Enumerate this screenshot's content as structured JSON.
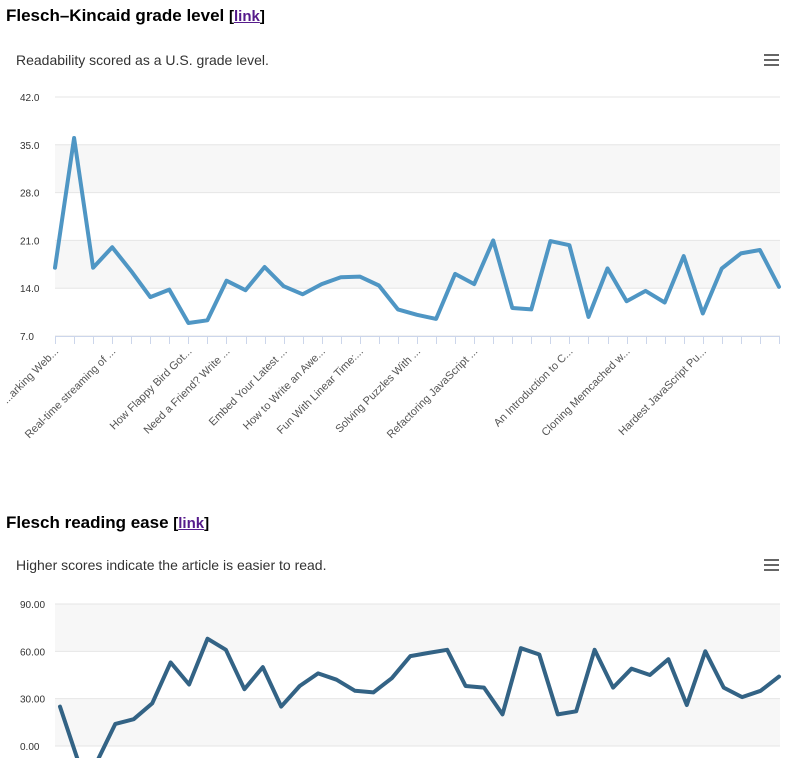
{
  "charts": [
    {
      "heading": "Flesch–Kincaid grade level",
      "link_text": "link",
      "subtitle": "Readability scored as a U.S. grade level.",
      "menu_icon": "hamburger-menu-icon",
      "color": "#4f96c4",
      "band_color": "#f7f7f7",
      "grid_color": "#e6e6e6"
    },
    {
      "heading": "Flesch reading ease",
      "link_text": "link",
      "subtitle": "Higher scores indicate the article is easier to read.",
      "menu_icon": "hamburger-menu-icon",
      "color": "#336385",
      "band_color": "#f7f7f7",
      "grid_color": "#e6e6e6"
    }
  ],
  "chart_data": [
    {
      "type": "line",
      "title": "Flesch–Kincaid grade level",
      "subtitle": "Readability scored as a U.S. grade level.",
      "xlabel": "",
      "ylabel": "",
      "ylim": [
        7,
        42
      ],
      "y_ticks": [
        "7.0",
        "14.0",
        "21.0",
        "28.0",
        "35.0",
        "42.0"
      ],
      "grid": true,
      "visible_x_labels": [
        "...arking Web...",
        "Real-time streaming of ...",
        "How Flappy Bird Got...",
        "Need a Friend? Write ...",
        "Embed Your Latest ...",
        "How to Write an Awe...",
        "Fun With Linear Time:...",
        "Solving Puzzles With ...",
        "Refactoring JavaScript ...",
        "An Introduction to C...",
        "Cloning Memcached w...",
        "Hardest JavaScript Pu..."
      ],
      "series": [
        {
          "values": [
            17,
            36,
            17,
            20,
            16.5,
            12.7,
            13.8,
            8.9,
            9.3,
            15.1,
            13.7,
            17.1,
            14.3,
            13.1,
            14.6,
            15.6,
            15.7,
            14.4,
            10.9,
            10.1,
            9.5,
            16.1,
            14.6,
            21,
            11.1,
            10.9,
            20.9,
            20.3,
            9.8,
            16.9,
            12.1,
            13.6,
            11.9,
            18.7,
            10.3,
            16.9,
            19.1,
            19.6,
            14.2
          ]
        }
      ]
    },
    {
      "type": "line",
      "title": "Flesch reading ease",
      "subtitle": "Higher scores indicate the article is easier to read.",
      "xlabel": "",
      "ylabel": "",
      "ylim": [
        0,
        90
      ],
      "y_ticks": [
        "0.00",
        "30.00",
        "60.00",
        "90.00"
      ],
      "grid": true,
      "series": [
        {
          "values": [
            25,
            -10,
            -10,
            14,
            17,
            27,
            53,
            39,
            68,
            61,
            36,
            50,
            25,
            38,
            46,
            42,
            35,
            34,
            43,
            57,
            59,
            61,
            38,
            37,
            20,
            62,
            58,
            20,
            22,
            61,
            37,
            49,
            45,
            55,
            26,
            60,
            37,
            31,
            35,
            44
          ]
        }
      ]
    }
  ]
}
